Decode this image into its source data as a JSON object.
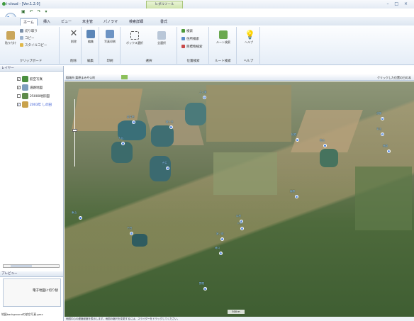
{
  "title": "i-cloud - [Ver.1.2.0]",
  "context_tab": "ヒダルツール",
  "context_subtab": "書式",
  "window_controls": "– □ ×",
  "logo_text": "e",
  "tabs": [
    {
      "label": "ホーム",
      "active": true
    },
    {
      "label": "挿入",
      "active": false
    },
    {
      "label": "ビュー",
      "active": false
    },
    {
      "label": "未主管",
      "active": false
    },
    {
      "label": "パノラマ",
      "active": false
    },
    {
      "label": "検索詳細",
      "active": false
    }
  ],
  "ribbon": {
    "clipboard": {
      "paste": "貼り付け",
      "cut": "切り取り",
      "copy": "コピー",
      "format": "スタイルコピー",
      "group": "クリップボード"
    },
    "delete": {
      "label": "削除",
      "group": "削除"
    },
    "edit": {
      "label": "編集",
      "group": "編集"
    },
    "photo": {
      "label": "写真印刷",
      "group": "印刷"
    },
    "box": {
      "label": "ボックス選択",
      "group": "選択"
    },
    "select_all": {
      "label": "全選択",
      "group": "選択"
    },
    "search": {
      "items": [
        "検索",
        "住所検索",
        "目標物検索"
      ],
      "group": "位置検索"
    },
    "route": {
      "label": "ルート検索",
      "group": "ルート検索"
    },
    "help": {
      "label": "ヘルプ",
      "group": "ヘルプ"
    }
  },
  "left_pane": {
    "layers_header": "レイヤー",
    "layers": [
      {
        "label": "航空写真",
        "checked": true,
        "color": "#4a8f3e"
      },
      {
        "label": "道路地図",
        "checked": true,
        "color": "#7d9ebd"
      },
      {
        "label": "25000地形図",
        "checked": false,
        "color": "#5d8a4a"
      },
      {
        "label": "2003年 しの田",
        "checked": true,
        "color": "#c9a24b"
      }
    ],
    "preview_header": "プレビュー",
    "preview_text": "電子地図に切り替",
    "preview_footer": "地図backgroundの航空写真.gmx"
  },
  "map_toolbar": {
    "path": "稲城市  栗原まみや公町",
    "hint": "クリックした位置の日の本"
  },
  "map": {
    "scale": "500 m",
    "markers": [
      {
        "id": "1",
        "label": "上ノ原"
      },
      {
        "id": "2",
        "label": "岩井田"
      },
      {
        "id": "3",
        "label": "桜ヶ丘"
      },
      {
        "id": "4",
        "label": "大谷"
      },
      {
        "id": "5",
        "label": "荒井"
      },
      {
        "id": "6",
        "label": "柏原"
      },
      {
        "id": "7",
        "label": "松山"
      },
      {
        "id": "8",
        "label": "北窪"
      },
      {
        "id": "9",
        "label": "平山"
      },
      {
        "id": "10",
        "label": "西原"
      },
      {
        "id": "11",
        "label": "南原"
      },
      {
        "id": "12",
        "label": "中村"
      },
      {
        "id": "13",
        "label": "東山"
      },
      {
        "id": "14",
        "label": "下田"
      },
      {
        "id": "15",
        "label": "宮ノ前"
      },
      {
        "id": "16",
        "label": "峠口"
      },
      {
        "id": "17",
        "label": "川口"
      },
      {
        "id": "18",
        "label": "野間"
      }
    ]
  },
  "status": "地図中心の緯度経度を表示します。地図の縮尺を変更するには、スライダーをドラッグしてください。"
}
